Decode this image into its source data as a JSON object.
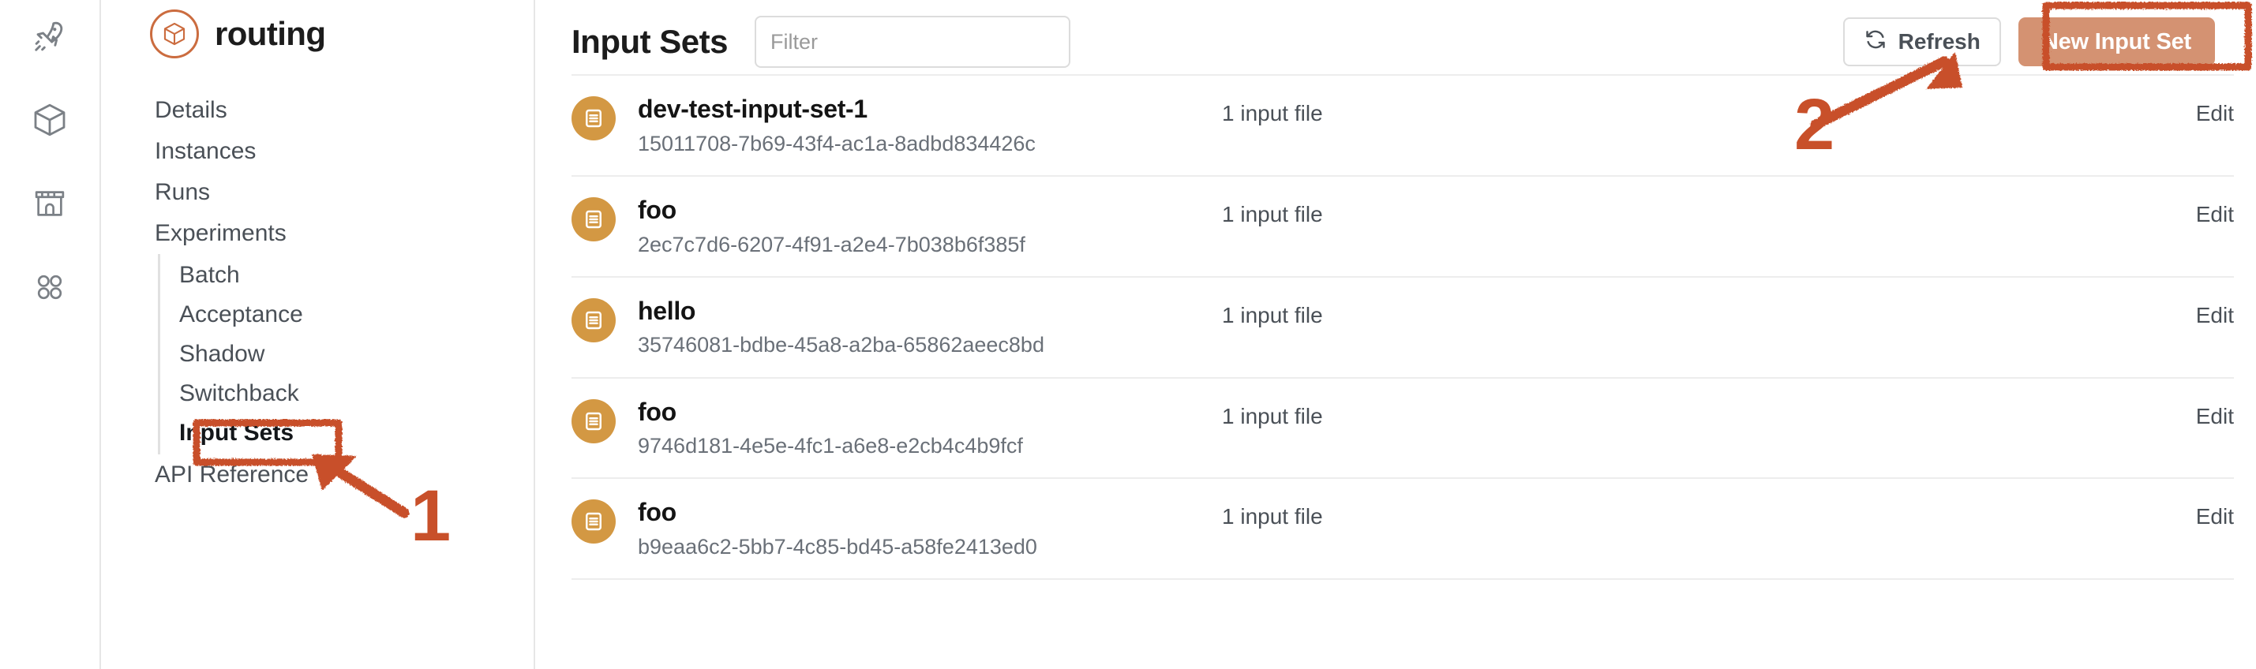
{
  "icon_rail": {
    "items": [
      {
        "name": "rocket-icon",
        "label": "Launch"
      },
      {
        "name": "cube-icon",
        "label": "Applications"
      },
      {
        "name": "store-icon",
        "label": "Marketplace"
      },
      {
        "name": "grid-icon",
        "label": "More"
      }
    ]
  },
  "sidebar": {
    "project_title": "routing",
    "project_logo_icon": "cube-outline-icon",
    "items": [
      {
        "label": "Details",
        "active": false
      },
      {
        "label": "Instances",
        "active": false
      },
      {
        "label": "Runs",
        "active": false
      },
      {
        "label": "Experiments",
        "active": false
      }
    ],
    "experiment_subitems": [
      {
        "label": "Batch",
        "active": false
      },
      {
        "label": "Acceptance",
        "active": false
      },
      {
        "label": "Shadow",
        "active": false
      },
      {
        "label": "Switchback",
        "active": false
      },
      {
        "label": "Input Sets",
        "active": true
      }
    ],
    "footer_items": [
      {
        "label": "API Reference",
        "active": false
      }
    ]
  },
  "header": {
    "title": "Input Sets",
    "filter_placeholder": "Filter",
    "filter_value": "",
    "refresh_label": "Refresh",
    "refresh_icon": "refresh-icon",
    "new_input_set_label": "New Input Set"
  },
  "list": {
    "row_icon": "list-document-icon",
    "edit_label": "Edit",
    "rows": [
      {
        "name": "dev-test-input-set-1",
        "id": "15011708-7b69-43f4-ac1a-8adbd834426c",
        "files": "1 input file",
        "edit": "Edit"
      },
      {
        "name": "foo",
        "id": "2ec7c7d6-6207-4f91-a2e4-7b038b6f385f",
        "files": "1 input file",
        "edit": "Edit"
      },
      {
        "name": "hello",
        "id": "35746081-bdbe-45a8-a2ba-65862aeec8bd",
        "files": "1 input file",
        "edit": "Edit"
      },
      {
        "name": "foo",
        "id": "9746d181-4e5e-4fc1-a6e8-e2cb4c4b9fcf",
        "files": "1 input file",
        "edit": "Edit"
      },
      {
        "name": "foo",
        "id": "b9eaa6c2-5bb7-4c85-bd45-a58fe2413ed0",
        "files": "1 input file",
        "edit": "Edit"
      }
    ]
  },
  "annotations": {
    "step_one": "1",
    "step_two": "2",
    "color": "#c8502a"
  },
  "colors": {
    "brand_orange": "#cb6c3f",
    "annotation_orange": "#c8502a",
    "row_icon_amber": "#d39843",
    "primary_button": "#d49272",
    "text_dark": "#1c1c1c",
    "text_muted": "#4a5057",
    "text_id": "#6a7078",
    "border": "#e6e6e6"
  }
}
